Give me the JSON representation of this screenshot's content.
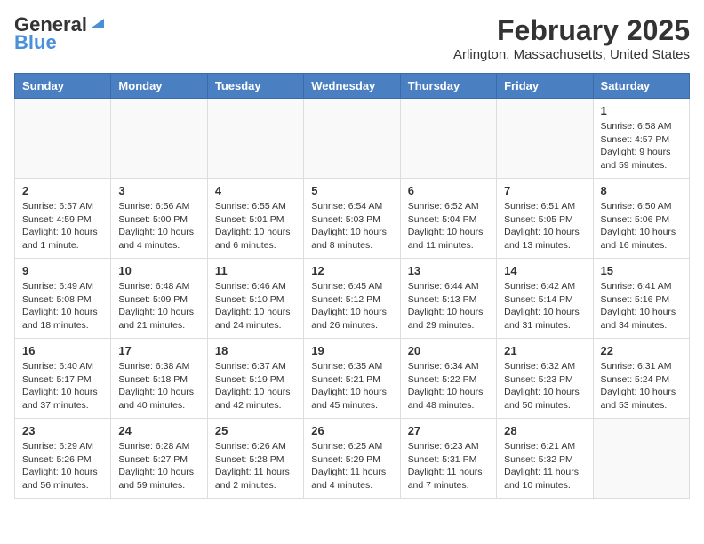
{
  "header": {
    "logo_general": "General",
    "logo_blue": "Blue",
    "month_title": "February 2025",
    "location": "Arlington, Massachusetts, United States"
  },
  "days_of_week": [
    "Sunday",
    "Monday",
    "Tuesday",
    "Wednesday",
    "Thursday",
    "Friday",
    "Saturday"
  ],
  "weeks": [
    [
      {
        "day": "",
        "info": ""
      },
      {
        "day": "",
        "info": ""
      },
      {
        "day": "",
        "info": ""
      },
      {
        "day": "",
        "info": ""
      },
      {
        "day": "",
        "info": ""
      },
      {
        "day": "",
        "info": ""
      },
      {
        "day": "1",
        "info": "Sunrise: 6:58 AM\nSunset: 4:57 PM\nDaylight: 9 hours and 59 minutes."
      }
    ],
    [
      {
        "day": "2",
        "info": "Sunrise: 6:57 AM\nSunset: 4:59 PM\nDaylight: 10 hours and 1 minute."
      },
      {
        "day": "3",
        "info": "Sunrise: 6:56 AM\nSunset: 5:00 PM\nDaylight: 10 hours and 4 minutes."
      },
      {
        "day": "4",
        "info": "Sunrise: 6:55 AM\nSunset: 5:01 PM\nDaylight: 10 hours and 6 minutes."
      },
      {
        "day": "5",
        "info": "Sunrise: 6:54 AM\nSunset: 5:03 PM\nDaylight: 10 hours and 8 minutes."
      },
      {
        "day": "6",
        "info": "Sunrise: 6:52 AM\nSunset: 5:04 PM\nDaylight: 10 hours and 11 minutes."
      },
      {
        "day": "7",
        "info": "Sunrise: 6:51 AM\nSunset: 5:05 PM\nDaylight: 10 hours and 13 minutes."
      },
      {
        "day": "8",
        "info": "Sunrise: 6:50 AM\nSunset: 5:06 PM\nDaylight: 10 hours and 16 minutes."
      }
    ],
    [
      {
        "day": "9",
        "info": "Sunrise: 6:49 AM\nSunset: 5:08 PM\nDaylight: 10 hours and 18 minutes."
      },
      {
        "day": "10",
        "info": "Sunrise: 6:48 AM\nSunset: 5:09 PM\nDaylight: 10 hours and 21 minutes."
      },
      {
        "day": "11",
        "info": "Sunrise: 6:46 AM\nSunset: 5:10 PM\nDaylight: 10 hours and 24 minutes."
      },
      {
        "day": "12",
        "info": "Sunrise: 6:45 AM\nSunset: 5:12 PM\nDaylight: 10 hours and 26 minutes."
      },
      {
        "day": "13",
        "info": "Sunrise: 6:44 AM\nSunset: 5:13 PM\nDaylight: 10 hours and 29 minutes."
      },
      {
        "day": "14",
        "info": "Sunrise: 6:42 AM\nSunset: 5:14 PM\nDaylight: 10 hours and 31 minutes."
      },
      {
        "day": "15",
        "info": "Sunrise: 6:41 AM\nSunset: 5:16 PM\nDaylight: 10 hours and 34 minutes."
      }
    ],
    [
      {
        "day": "16",
        "info": "Sunrise: 6:40 AM\nSunset: 5:17 PM\nDaylight: 10 hours and 37 minutes."
      },
      {
        "day": "17",
        "info": "Sunrise: 6:38 AM\nSunset: 5:18 PM\nDaylight: 10 hours and 40 minutes."
      },
      {
        "day": "18",
        "info": "Sunrise: 6:37 AM\nSunset: 5:19 PM\nDaylight: 10 hours and 42 minutes."
      },
      {
        "day": "19",
        "info": "Sunrise: 6:35 AM\nSunset: 5:21 PM\nDaylight: 10 hours and 45 minutes."
      },
      {
        "day": "20",
        "info": "Sunrise: 6:34 AM\nSunset: 5:22 PM\nDaylight: 10 hours and 48 minutes."
      },
      {
        "day": "21",
        "info": "Sunrise: 6:32 AM\nSunset: 5:23 PM\nDaylight: 10 hours and 50 minutes."
      },
      {
        "day": "22",
        "info": "Sunrise: 6:31 AM\nSunset: 5:24 PM\nDaylight: 10 hours and 53 minutes."
      }
    ],
    [
      {
        "day": "23",
        "info": "Sunrise: 6:29 AM\nSunset: 5:26 PM\nDaylight: 10 hours and 56 minutes."
      },
      {
        "day": "24",
        "info": "Sunrise: 6:28 AM\nSunset: 5:27 PM\nDaylight: 10 hours and 59 minutes."
      },
      {
        "day": "25",
        "info": "Sunrise: 6:26 AM\nSunset: 5:28 PM\nDaylight: 11 hours and 2 minutes."
      },
      {
        "day": "26",
        "info": "Sunrise: 6:25 AM\nSunset: 5:29 PM\nDaylight: 11 hours and 4 minutes."
      },
      {
        "day": "27",
        "info": "Sunrise: 6:23 AM\nSunset: 5:31 PM\nDaylight: 11 hours and 7 minutes."
      },
      {
        "day": "28",
        "info": "Sunrise: 6:21 AM\nSunset: 5:32 PM\nDaylight: 11 hours and 10 minutes."
      },
      {
        "day": "",
        "info": ""
      }
    ]
  ]
}
